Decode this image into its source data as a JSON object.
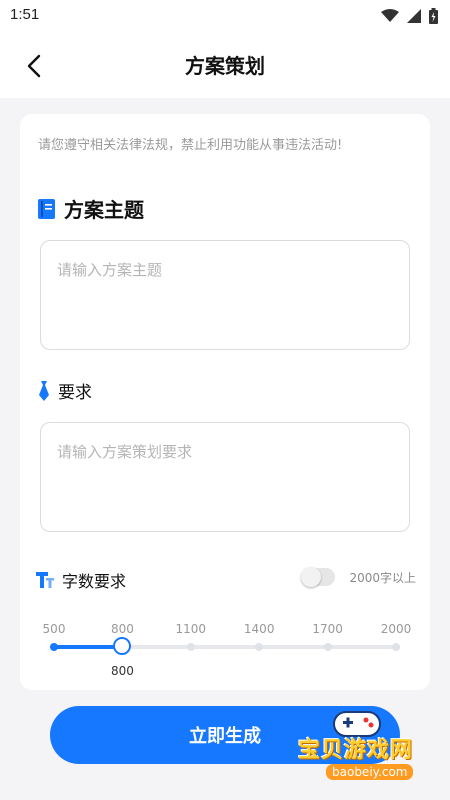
{
  "status_bar": {
    "time": "1:51"
  },
  "header": {
    "title": "方案策划",
    "back_icon": "chevron-left-icon"
  },
  "notice": "请您遵守相关法律法规，禁止利用功能从事违法活动!",
  "topic_section": {
    "title": "方案主题",
    "icon": "book-icon",
    "placeholder": "请输入方案主题"
  },
  "requirement_section": {
    "title": "要求",
    "icon": "tie-icon",
    "placeholder": "请输入方案策划要求"
  },
  "word_count_section": {
    "title": "字数要求",
    "icon": "text-t-icon",
    "toggle_label": "2000字以上",
    "toggle_on": false,
    "ticks": [
      "500",
      "800",
      "1100",
      "1400",
      "1700",
      "2000"
    ],
    "selected_value": "800",
    "selected_index": 1
  },
  "submit_label": "立即生成",
  "watermark": {
    "text": "宝贝游戏网",
    "url": "baobeiy.com"
  },
  "colors": {
    "accent": "#1677ff",
    "background": "#f4f4f6"
  }
}
